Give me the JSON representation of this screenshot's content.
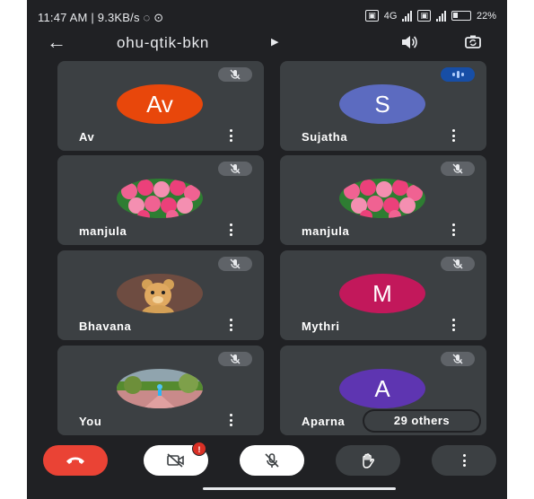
{
  "status_bar": {
    "time": "11:47 AM",
    "net_speed": "9.3KB/s",
    "sim1": "4G",
    "battery": "22%"
  },
  "meeting": {
    "code": "ohu-qtik-bkn"
  },
  "participants": [
    {
      "name": "Av",
      "initials": "Av",
      "avatar_color": "#e8470b",
      "avatar_type": "initials",
      "mic": "muted"
    },
    {
      "name": "Sujatha",
      "initials": "S",
      "avatar_color": "#5c6bc0",
      "avatar_type": "initials",
      "mic": "speaking"
    },
    {
      "name": "manjula",
      "avatar_type": "photo-roses",
      "mic": "muted"
    },
    {
      "name": "manjula",
      "avatar_type": "photo-roses",
      "mic": "muted"
    },
    {
      "name": "Bhavana",
      "avatar_type": "photo-teddy",
      "mic": "muted"
    },
    {
      "name": "Mythri",
      "initials": "M",
      "avatar_color": "#c2185b",
      "avatar_type": "initials",
      "mic": "muted"
    },
    {
      "name": "You",
      "avatar_type": "photo-field",
      "mic": "muted"
    },
    {
      "name": "Aparna",
      "initials": "A",
      "avatar_color": "#5e35b1",
      "avatar_type": "initials",
      "mic": "muted"
    }
  ],
  "others_chip": "29 others",
  "controls": {
    "end_call": {
      "icon": "phone-hangup-icon",
      "color": "#ea4335"
    },
    "camera": {
      "icon": "camera-off-icon",
      "badge": "!"
    },
    "mic": {
      "icon": "mic-off-icon"
    },
    "raise_hand": {
      "icon": "hand-icon"
    },
    "more": {
      "icon": "more-vertical-icon"
    }
  }
}
